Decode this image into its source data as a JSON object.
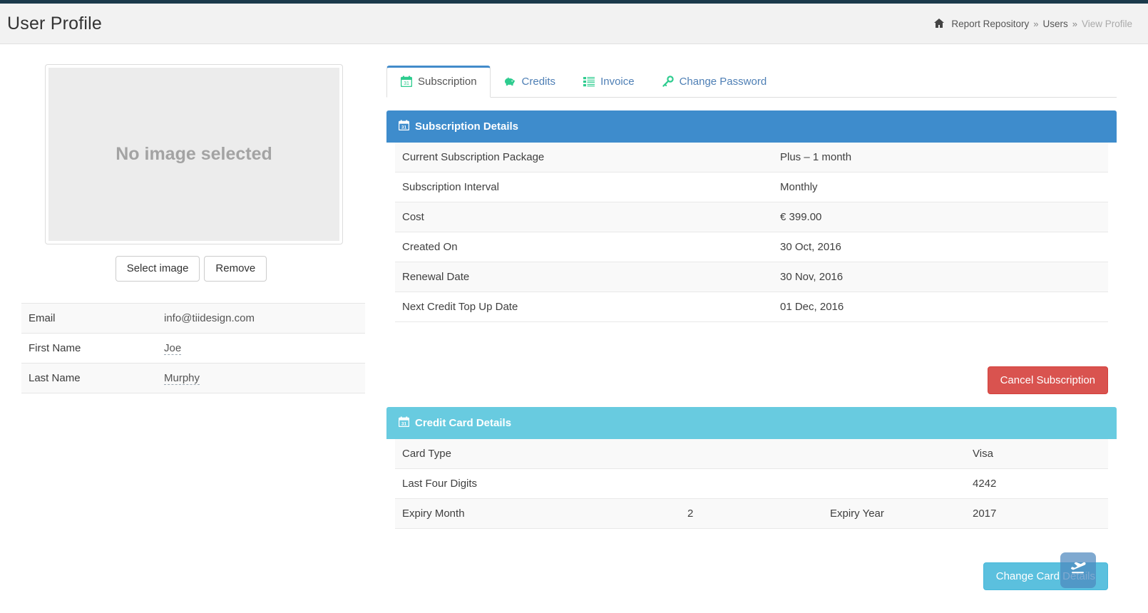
{
  "header": {
    "title": "User Profile",
    "breadcrumb": {
      "home_icon": "home-icon",
      "items": [
        "Report Repository",
        "Users",
        "View Profile"
      ],
      "separator": "»"
    }
  },
  "profile": {
    "image": {
      "placeholder_text": "No image selected",
      "select_label": "Select image",
      "remove_label": "Remove"
    },
    "fields": [
      {
        "label": "Email",
        "value": "info@tiidesign.com",
        "editable": false
      },
      {
        "label": "First Name",
        "value": "Joe",
        "editable": true
      },
      {
        "label": "Last Name",
        "value": "Murphy",
        "editable": true
      }
    ]
  },
  "tabs": [
    {
      "label": "Subscription",
      "icon": "calendar-icon",
      "active": true
    },
    {
      "label": "Credits",
      "icon": "piggy-bank-icon",
      "active": false
    },
    {
      "label": "Invoice",
      "icon": "list-icon",
      "active": false
    },
    {
      "label": "Change Password",
      "icon": "key-icon",
      "active": false
    }
  ],
  "subscription_panel": {
    "title": "Subscription Details",
    "icon": "calendar-icon",
    "rows": [
      {
        "label": "Current Subscription Package",
        "value": "Plus – 1 month"
      },
      {
        "label": "Subscription Interval",
        "value": "Monthly"
      },
      {
        "label": "Cost",
        "value": "€ 399.00"
      },
      {
        "label": "Created On",
        "value": "30 Oct, 2016"
      },
      {
        "label": "Renewal Date",
        "value": "30 Nov, 2016"
      },
      {
        "label": "Next Credit Top Up Date",
        "value": "01 Dec, 2016"
      }
    ],
    "cancel_label": "Cancel Subscription"
  },
  "credit_card_panel": {
    "title": "Credit Card Details",
    "icon": "calendar-icon",
    "rows": [
      {
        "label": "Card Type",
        "value": "Visa"
      },
      {
        "label": "Last Four Digits",
        "value": "4242"
      }
    ],
    "expiry_row": {
      "month_label": "Expiry Month",
      "month_value": "2",
      "year_label": "Expiry Year",
      "year_value": "2017"
    },
    "change_label": "Change Card Details"
  },
  "fab": {
    "icon": "plane-departure-icon"
  },
  "colors": {
    "topbar": "#1b3a4b",
    "primary": "#3e8ccc",
    "info": "#68cbe0",
    "danger": "#d9534f",
    "tab_link": "#4e7fb5",
    "tab_icon_green": "#2ecc8f"
  }
}
